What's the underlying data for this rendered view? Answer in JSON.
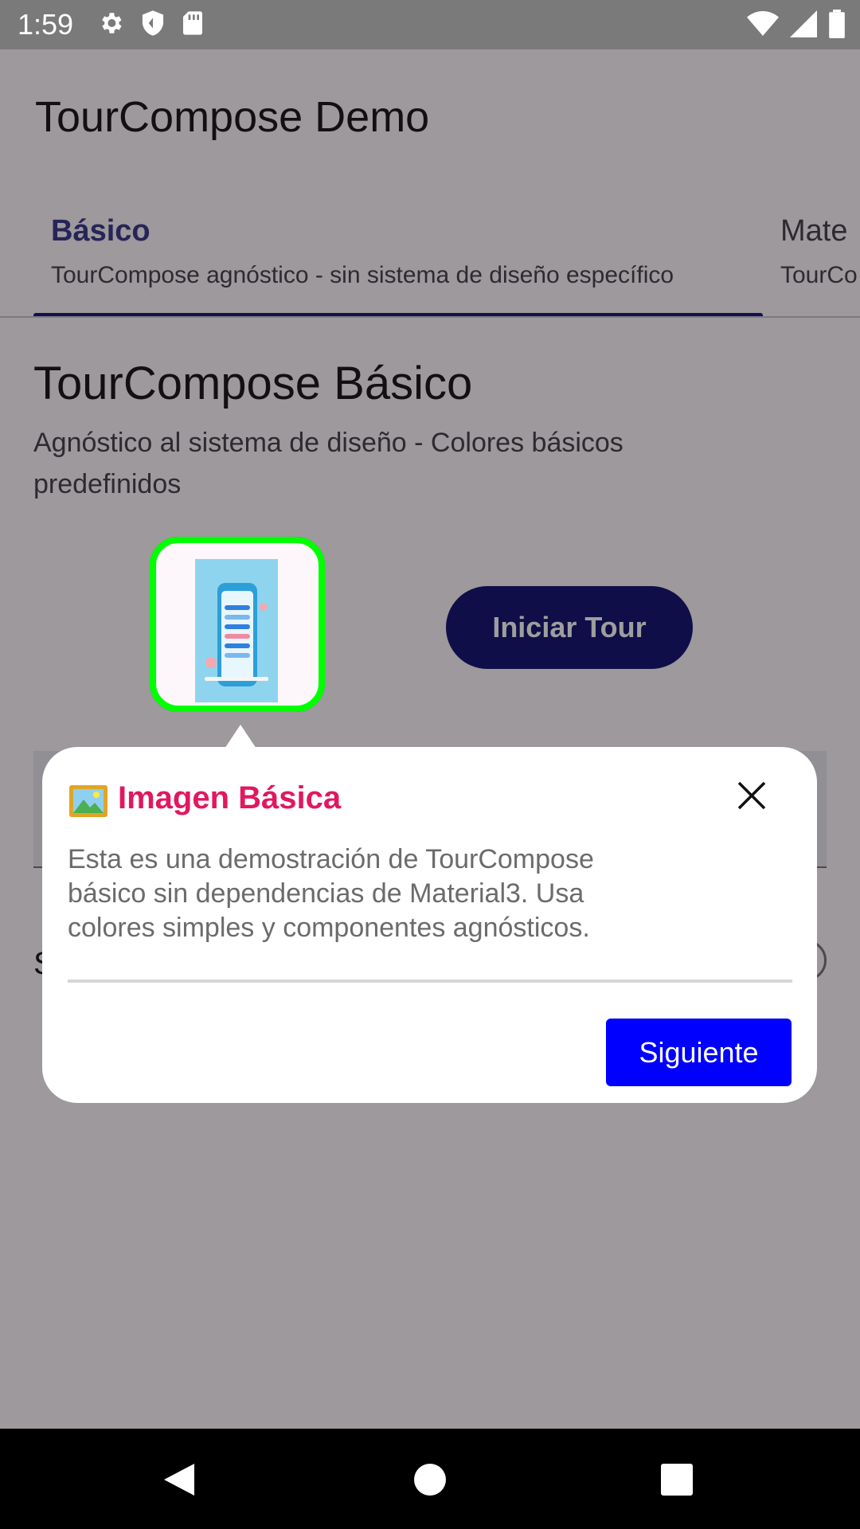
{
  "status_bar": {
    "time": "1:59",
    "left_icons": [
      "settings-icon",
      "shield-icon",
      "sd-card-icon"
    ],
    "right_icons": [
      "wifi-icon",
      "signal-icon",
      "battery-icon"
    ]
  },
  "header": {
    "title": "TourCompose Demo",
    "theme_icon": "moon-icon"
  },
  "tabs": [
    {
      "title": "Básico",
      "subtitle": "TourCompose agnóstico - sin sistema de diseño específico",
      "selected": true
    },
    {
      "title": "Mate",
      "subtitle": "TourCo",
      "selected": false
    }
  ],
  "main": {
    "title": "TourCompose Básico",
    "subtitle": "Agnóstico al sistema de diseño - Colores básicos predefinidos",
    "start_tour_label": "Iniciar Tour",
    "hidden_row_letter": "S"
  },
  "tooltip": {
    "icon": "framed-picture-icon",
    "title": "Imagen Básica",
    "body": "Esta es una demostración de TourCompose básico sin dependencias de Material3. Usa colores simples y componentes agnósticos.",
    "next_label": "Siguiente",
    "close_icon": "close-icon"
  },
  "colors": {
    "highlight_border": "#00ff00",
    "tooltip_title": "#e0185f",
    "next_button": "#0000ff",
    "primary": "#1a1875"
  },
  "nav_bar": [
    "back-icon",
    "home-icon",
    "recents-icon"
  ]
}
